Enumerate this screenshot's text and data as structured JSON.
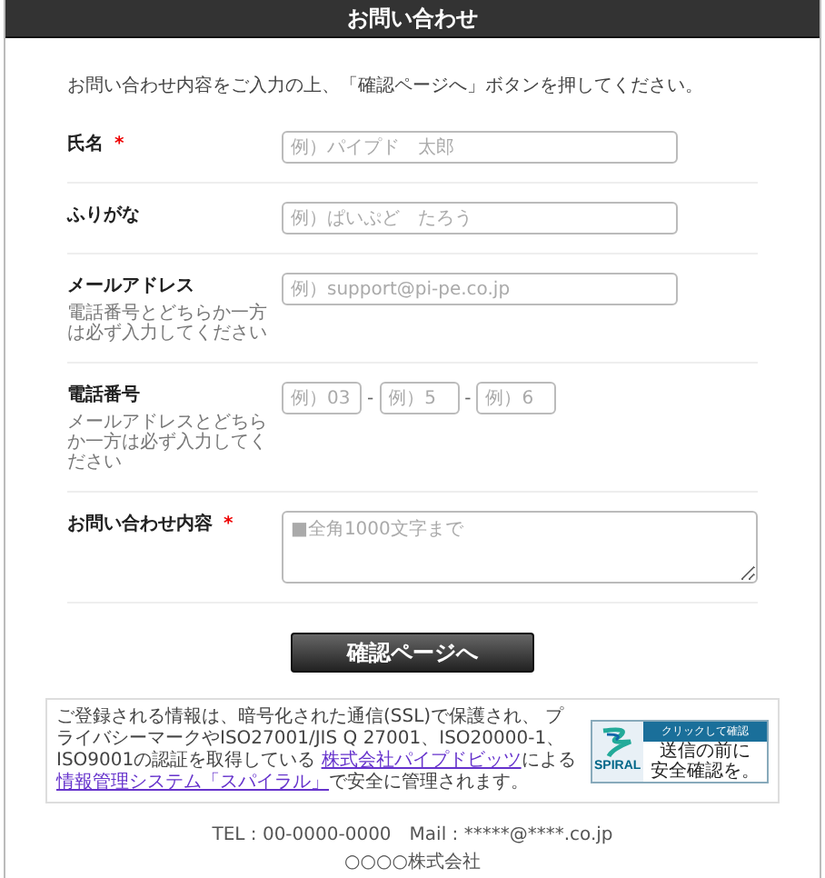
{
  "header": {
    "title": "お問い合わせ"
  },
  "intro": "お問い合わせ内容をご入力の上、「確認ページへ」ボタンを押してください。",
  "fields": [
    {
      "kind": "text",
      "label": "氏名",
      "required_mark": "*",
      "placeholder": "例）パイプド　太郎"
    },
    {
      "kind": "text",
      "label": "ふりがな",
      "placeholder": "例）ぱいぷど　たろう"
    },
    {
      "kind": "text",
      "label": "メールアドレス",
      "hint": "電話番号とどちらか一方は必ず入力してください",
      "placeholder": "例）support@pi-pe.co.jp"
    },
    {
      "kind": "tel",
      "label": "電話番号",
      "hint": "メールアドレスとどちらか一方は必ず入力してください",
      "parts": [
        {
          "placeholder": "例）03"
        },
        {
          "placeholder": "例）5"
        },
        {
          "placeholder": "例）6"
        }
      ],
      "separator": "-"
    },
    {
      "kind": "textarea",
      "label": "お問い合わせ内容",
      "required_mark": "*",
      "placeholder": "■全角1000文字まで"
    }
  ],
  "submit": {
    "label": "確認ページへ"
  },
  "notice": {
    "segments": [
      {
        "kind": "text",
        "text": "ご登録される情報は、暗号化された通信(SSL)で保護され、 プライバシーマークやISO27001/JIS Q 27001、ISO20000-1、ISO9001の認証を取得している "
      },
      {
        "kind": "link",
        "text": "株式会社パイプドビッツ"
      },
      {
        "kind": "text",
        "text": "による"
      },
      {
        "kind": "link",
        "text": "情報管理システム「スパイラル」"
      },
      {
        "kind": "text",
        "text": "で安全に管理されます。"
      }
    ],
    "badge": {
      "caption": "クリックして確認",
      "lines": [
        "送信の前に",
        "安全確認を。"
      ],
      "logo": "SPIRAL"
    }
  },
  "footer": {
    "contact": "TEL : 00-0000-0000　Mail : *****@****.co.jp",
    "company": "○○○○株式会社"
  }
}
